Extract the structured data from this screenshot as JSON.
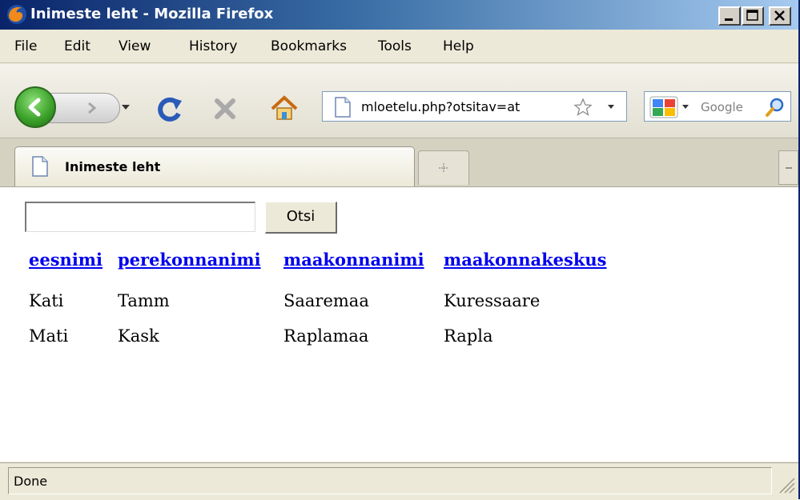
{
  "window": {
    "title": "Inimeste leht - Mozilla Firefox"
  },
  "menu": [
    "File",
    "Edit",
    "View",
    "History",
    "Bookmarks",
    "Tools",
    "Help"
  ],
  "nav": {
    "url": "mloetelu.php?otsitav=at",
    "search_placeholder": "Google"
  },
  "tab": {
    "label": "Inimeste leht"
  },
  "form": {
    "query_value": "",
    "submit_label": "Otsi"
  },
  "table": {
    "headers": [
      "eesnimi",
      "perekonnanimi",
      "maakonnanimi",
      "maakonnakeskus"
    ],
    "rows": [
      [
        "Kati",
        "Tamm",
        "Saaremaa",
        "Kuressaare"
      ],
      [
        "Mati",
        "Kask",
        "Raplamaa",
        "Rapla"
      ]
    ]
  },
  "status": {
    "text": "Done"
  },
  "colors": {
    "titlebar": "#0a246a",
    "link": "#0000ee",
    "chrome": "#ece9d8"
  },
  "icons": [
    "firefox-icon",
    "back-icon",
    "forward-icon",
    "dropdown-icon",
    "reload-icon",
    "stop-icon",
    "home-icon",
    "page-icon",
    "bookmark-star-icon",
    "google-icon",
    "search-icon",
    "new-tab-icon",
    "resize-grip-icon"
  ]
}
